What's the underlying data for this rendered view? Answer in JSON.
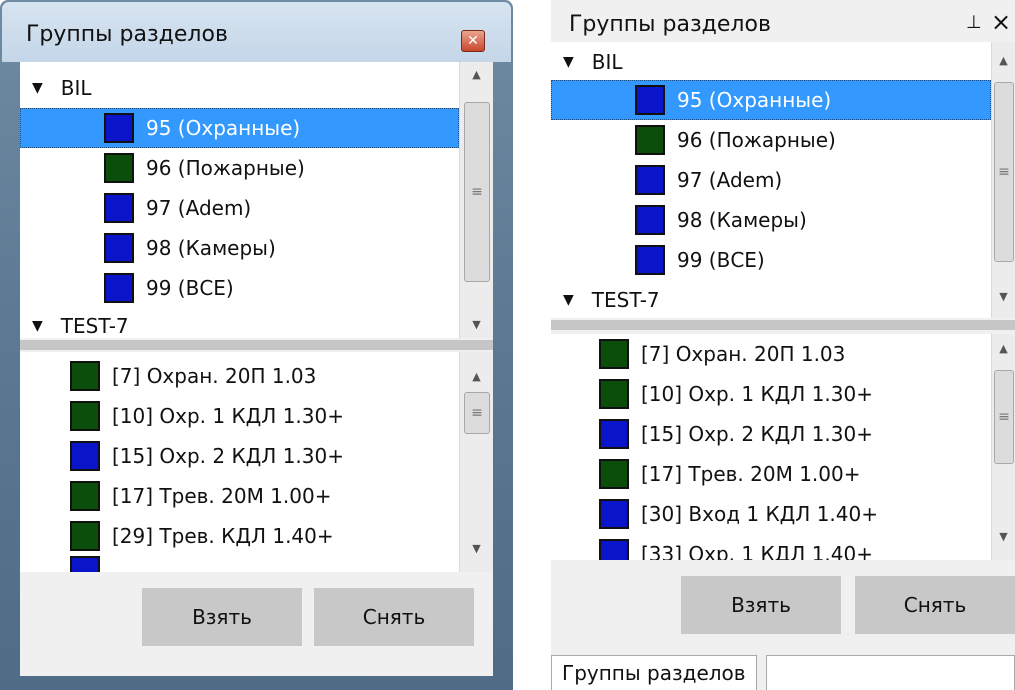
{
  "colors": {
    "blue": "#0a14c8",
    "green": "#0b4d0b",
    "selection": "#3399ff"
  },
  "left_window": {
    "title": "Группы разделов",
    "groups_tree": [
      {
        "label": "BIL",
        "expanded": true,
        "items": [
          {
            "label": "95 (Охранные)",
            "color": "blue",
            "selected": true
          },
          {
            "label": "96 (Пожарные)",
            "color": "green"
          },
          {
            "label": "97 (Adem)",
            "color": "blue"
          },
          {
            "label": "98 (Камеры)",
            "color": "blue"
          },
          {
            "label": "99 (ВСЕ)",
            "color": "blue"
          }
        ]
      },
      {
        "label": "TEST-7",
        "expanded": true
      }
    ],
    "devices": [
      {
        "label": "[7] Охран. 20П 1.03",
        "color": "green"
      },
      {
        "label": "[10] Охр. 1 КДЛ 1.30+",
        "color": "green"
      },
      {
        "label": "[15] Охр. 2 КДЛ 1.30+",
        "color": "blue"
      },
      {
        "label": "[17] Трев. 20М 1.00+",
        "color": "green"
      },
      {
        "label": "[29] Трев. КДЛ 1.40+",
        "color": "green"
      }
    ],
    "buttons": {
      "take": "Взять",
      "release": "Снять"
    }
  },
  "right_window": {
    "title": "Группы разделов",
    "groups_tree": [
      {
        "label": "BIL",
        "expanded": true,
        "items": [
          {
            "label": "95 (Охранные)",
            "color": "blue",
            "selected": true
          },
          {
            "label": "96 (Пожарные)",
            "color": "green"
          },
          {
            "label": "97 (Adem)",
            "color": "blue"
          },
          {
            "label": "98 (Камеры)",
            "color": "blue"
          },
          {
            "label": "99 (ВСЕ)",
            "color": "blue"
          }
        ]
      },
      {
        "label": "TEST-7",
        "expanded": true
      }
    ],
    "devices": [
      {
        "label": "[7] Охран. 20П 1.03",
        "color": "green"
      },
      {
        "label": "[10] Охр. 1 КДЛ 1.30+",
        "color": "green"
      },
      {
        "label": "[15] Охр. 2 КДЛ 1.30+",
        "color": "blue"
      },
      {
        "label": "[17] Трев. 20М 1.00+",
        "color": "green"
      },
      {
        "label": "[30] Вход 1 КДЛ 1.40+",
        "color": "blue"
      },
      {
        "label": "[33] Охр. 1 КДЛ 1.40+",
        "color": "blue"
      }
    ],
    "buttons": {
      "take": "Взять",
      "release": "Снять"
    },
    "tab_label": "Группы разделов"
  }
}
